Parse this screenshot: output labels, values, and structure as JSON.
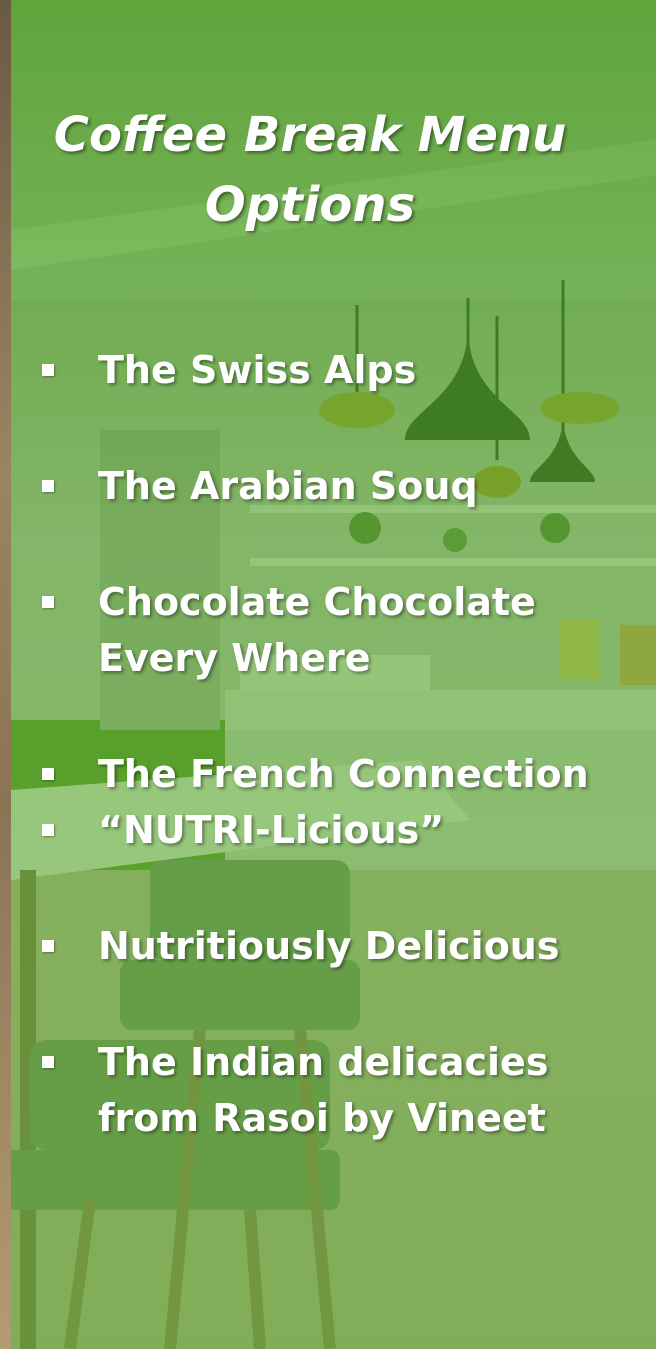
{
  "slide": {
    "title": "Coffee Break Menu Options",
    "items": [
      {
        "label": "The Swiss Alps"
      },
      {
        "label": "The Arabian Souq"
      },
      {
        "label": "Chocolate Chocolate Every Where"
      },
      {
        "label": "The French Connection"
      },
      {
        "label": "“NUTRI-Licious”"
      },
      {
        "label": "Nutritiously Delicious"
      },
      {
        "label": "The Indian delicacies from Rasoi by Vineet"
      }
    ]
  },
  "colors": {
    "overlay_green": "#4f9a1e",
    "text": "#ffffff"
  }
}
